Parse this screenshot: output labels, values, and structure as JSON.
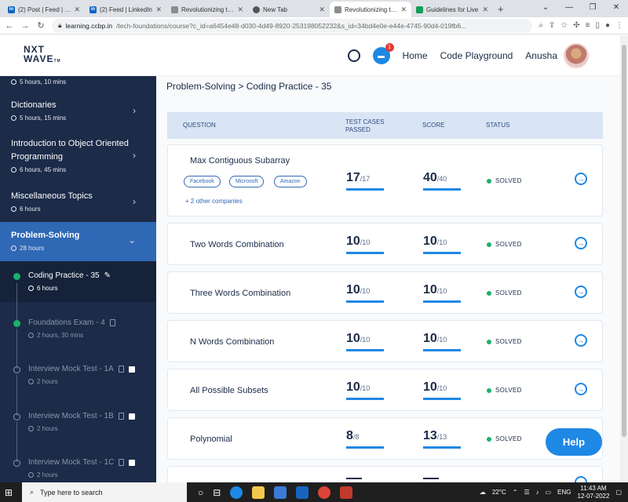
{
  "browser": {
    "tabs": [
      {
        "label": "(2) Post | Feed | Lin",
        "favicon": "linkedin-icon",
        "color": "#0a66c2",
        "active": false
      },
      {
        "label": "(2) Feed | LinkedIn",
        "favicon": "linkedin-icon",
        "color": "#0a66c2",
        "active": false
      },
      {
        "label": "Revolutionizing the",
        "favicon": "doc-icon",
        "color": "#8c8c8c",
        "active": false
      },
      {
        "label": "New Tab",
        "favicon": "chrome-icon",
        "color": "#555555",
        "active": false
      },
      {
        "label": "Revolutionizing the",
        "favicon": "doc-icon",
        "color": "#8c8c8c",
        "active": true
      },
      {
        "label": "Guidelines for Live",
        "favicon": "sheets-icon",
        "color": "#0f9d58",
        "active": false
      }
    ],
    "url_host": "learning.ccbp.in",
    "url_rest": "/tech-foundations/course?c_id=a6454e48-d030-4d49-8920-253198052232&s_id=34bd4e0e-e44e-4745-90d4-019fb6..."
  },
  "header": {
    "logo_line1": "NXT",
    "logo_line2": "WAVE",
    "logo_tm": "TM",
    "chat_badge": "1",
    "nav_home": "Home",
    "nav_playground": "Code Playground",
    "user_name": "Anusha"
  },
  "sidebar": {
    "top_partial_meta": "5 hours, 10 mins",
    "topics": [
      {
        "title": "Dictionaries",
        "meta": "5 hours, 15 mins"
      },
      {
        "title": "Introduction to Object Oriented Programming",
        "meta": "6 hours, 45 mins"
      },
      {
        "title": "Miscellaneous Topics",
        "meta": "6 hours"
      },
      {
        "title": "Problem-Solving",
        "meta": "28 hours"
      }
    ],
    "subitems": [
      {
        "title": "Coding Practice - 35",
        "meta": "6 hours",
        "state": "current"
      },
      {
        "title": "Foundations Exam - 4",
        "meta": "2 hours, 30 mins",
        "state": "done"
      },
      {
        "title": "Interview Mock Test - 1A",
        "meta": "2 hours",
        "state": "locked"
      },
      {
        "title": "Interview Mock Test - 1B",
        "meta": "2 hours",
        "state": "locked"
      },
      {
        "title": "Interview Mock Test - 1C",
        "meta": "2 hours",
        "state": "locked"
      }
    ]
  },
  "main": {
    "breadcrumb": "Problem-Solving > Coding Practice - 35",
    "columns": {
      "question": "QUESTION",
      "test_cases": "TEST CASES PASSED",
      "score": "SCORE",
      "status": "STATUS"
    },
    "questions": [
      {
        "name": "Max Contiguous Subarray",
        "tc": "17",
        "tc_total": "/17",
        "score": "40",
        "score_total": "/40",
        "status": "SOLVED",
        "companies": [
          "Facebook",
          "Microsoft",
          "Amazon"
        ],
        "more": "+ 2 other companies"
      },
      {
        "name": "Two Words Combination",
        "tc": "10",
        "tc_total": "/10",
        "score": "10",
        "score_total": "/10",
        "status": "SOLVED"
      },
      {
        "name": "Three Words Combination",
        "tc": "10",
        "tc_total": "/10",
        "score": "10",
        "score_total": "/10",
        "status": "SOLVED"
      },
      {
        "name": "N Words Combination",
        "tc": "10",
        "tc_total": "/10",
        "score": "10",
        "score_total": "/10",
        "status": "SOLVED"
      },
      {
        "name": "All Possible Subsets",
        "tc": "10",
        "tc_total": "/10",
        "score": "10",
        "score_total": "/10",
        "status": "SOLVED"
      },
      {
        "name": "Polynomial",
        "tc": "8",
        "tc_total": "/8",
        "score": "13",
        "score_total": "/13",
        "status": "SOLVED"
      }
    ],
    "help": "Help"
  },
  "taskbar": {
    "search_placeholder": "Type here to search",
    "weather": "22°C",
    "lang": "ENG",
    "time": "11:43 AM",
    "date": "12-07-2022"
  }
}
